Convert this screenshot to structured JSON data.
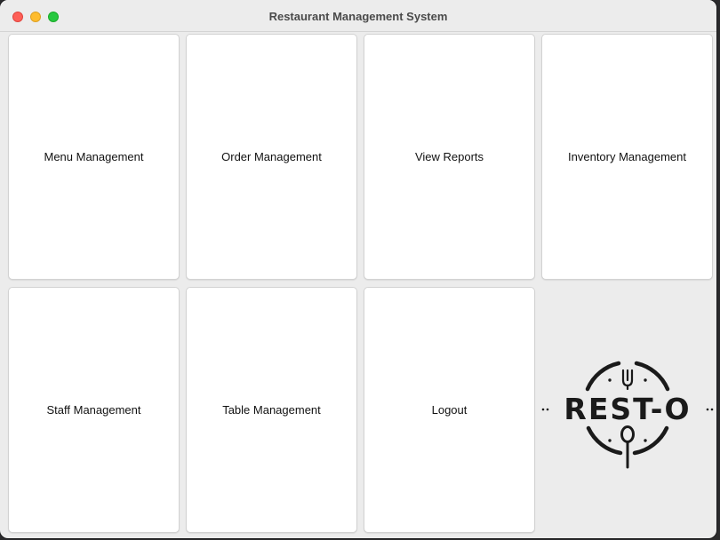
{
  "window": {
    "title": "Restaurant Management System"
  },
  "buttons": {
    "menu": "Menu Management",
    "order": "Order Management",
    "reports": "View Reports",
    "inventory": "Inventory Management",
    "staff": "Staff Management",
    "table": "Table Management",
    "logout": "Logout"
  },
  "logo": {
    "text": "REST-O",
    "icons": [
      "fork-icon",
      "spoon-icon"
    ]
  },
  "colors": {
    "window_bg": "#ececec",
    "tile_bg": "#ffffff",
    "close": "#fe5f57",
    "minimize": "#febc2e",
    "maximize": "#28c840",
    "logo": "#1a1a1a"
  }
}
